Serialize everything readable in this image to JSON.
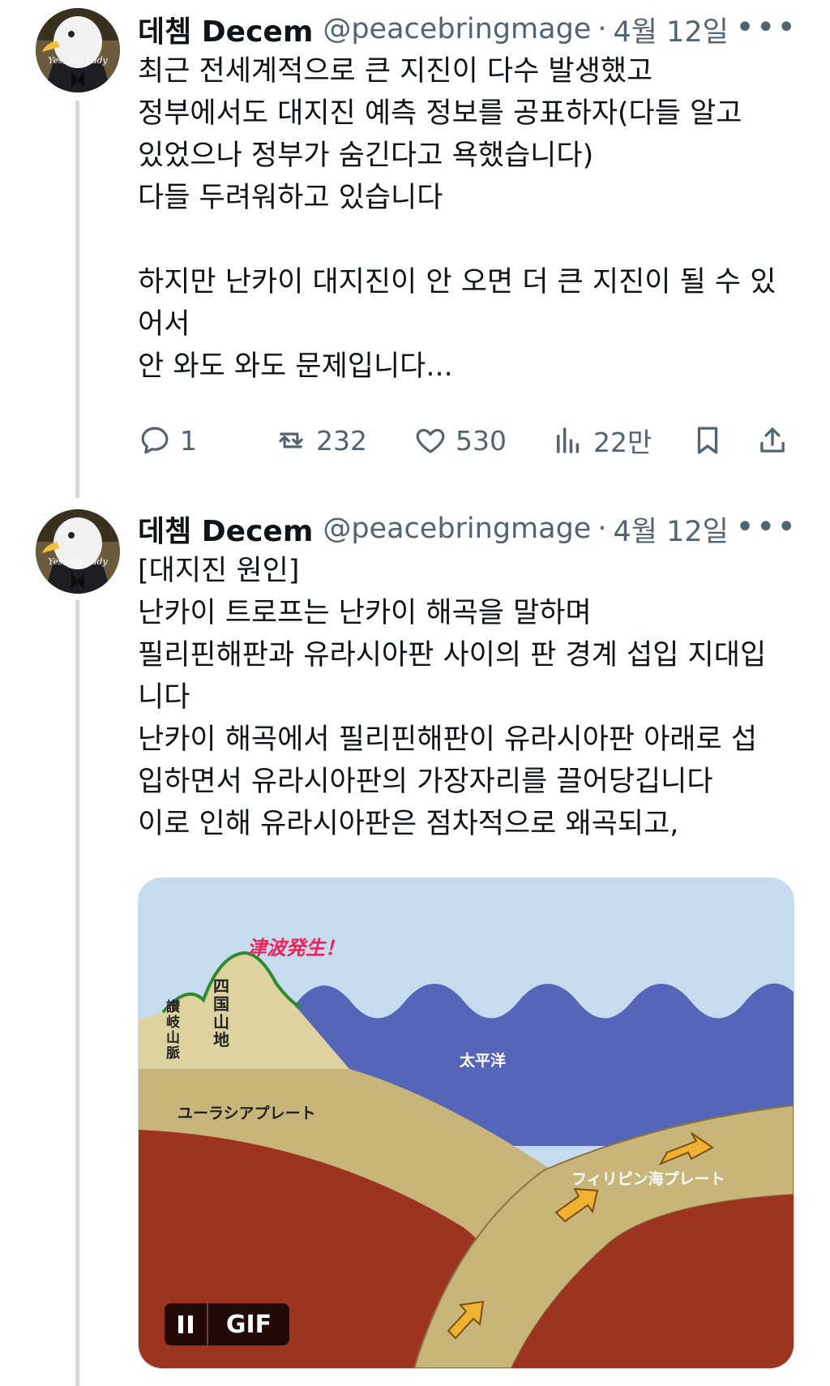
{
  "tweets": [
    {
      "name": "데쳄 Decem",
      "handle": "@peacebringmage",
      "date": "4월 12일",
      "avatar_text": "Yes, My Lady",
      "text": "최근 전세계적으로 큰 지진이 다수 발생했고\n정부에서도 대지진 예측 정보를 공표하자(다들 알고\n있었으나 정부가 숨긴다고 욕했습니다)\n다들 두려워하고 있습니다\n\n하지만 난카이 대지진이 안 오면 더 큰 지진이 될 수 있\n어서\n안 와도 와도 문제입니다...",
      "actions": {
        "replies": "1",
        "reposts": "232",
        "likes": "530",
        "views": "22만"
      }
    },
    {
      "name": "데쳄 Decem",
      "handle": "@peacebringmage",
      "date": "4월 12일",
      "avatar_text": "Yes, My Lady",
      "text": "[대지진 원인]\n난카이 트로프는 난카이 해곡을 말하며\n필리핀해판과 유라시아판 사이의 판 경계 섭입 지대입\n니다\n난카이 해곡에서 필리핀해판이 유라시아판 아래로 섭\n입하면서 유라시아판의 가장자리를 끌어당깁니다\n이로 인해 유라시아판은 점차적으로 왜곡되고,"
    }
  ],
  "media": {
    "tsunami": "津波発生！",
    "sanuki": "讃岐山脈",
    "shikoku": "四国山地",
    "pacific": "太平洋",
    "eurasia": "ユーラシアプレート",
    "philippine": "フィリピン海プレート",
    "gif_label": "GIF"
  },
  "colors": {
    "sky": "#c7dbef",
    "ocean": "#5566b8",
    "land": "#ddd2a0",
    "plate": "#c8b57a",
    "mantle": "#9c3420",
    "mountain_line": "#2f8a2f",
    "arrow": "#f0b030",
    "tsunami_text": "#e8245a"
  }
}
